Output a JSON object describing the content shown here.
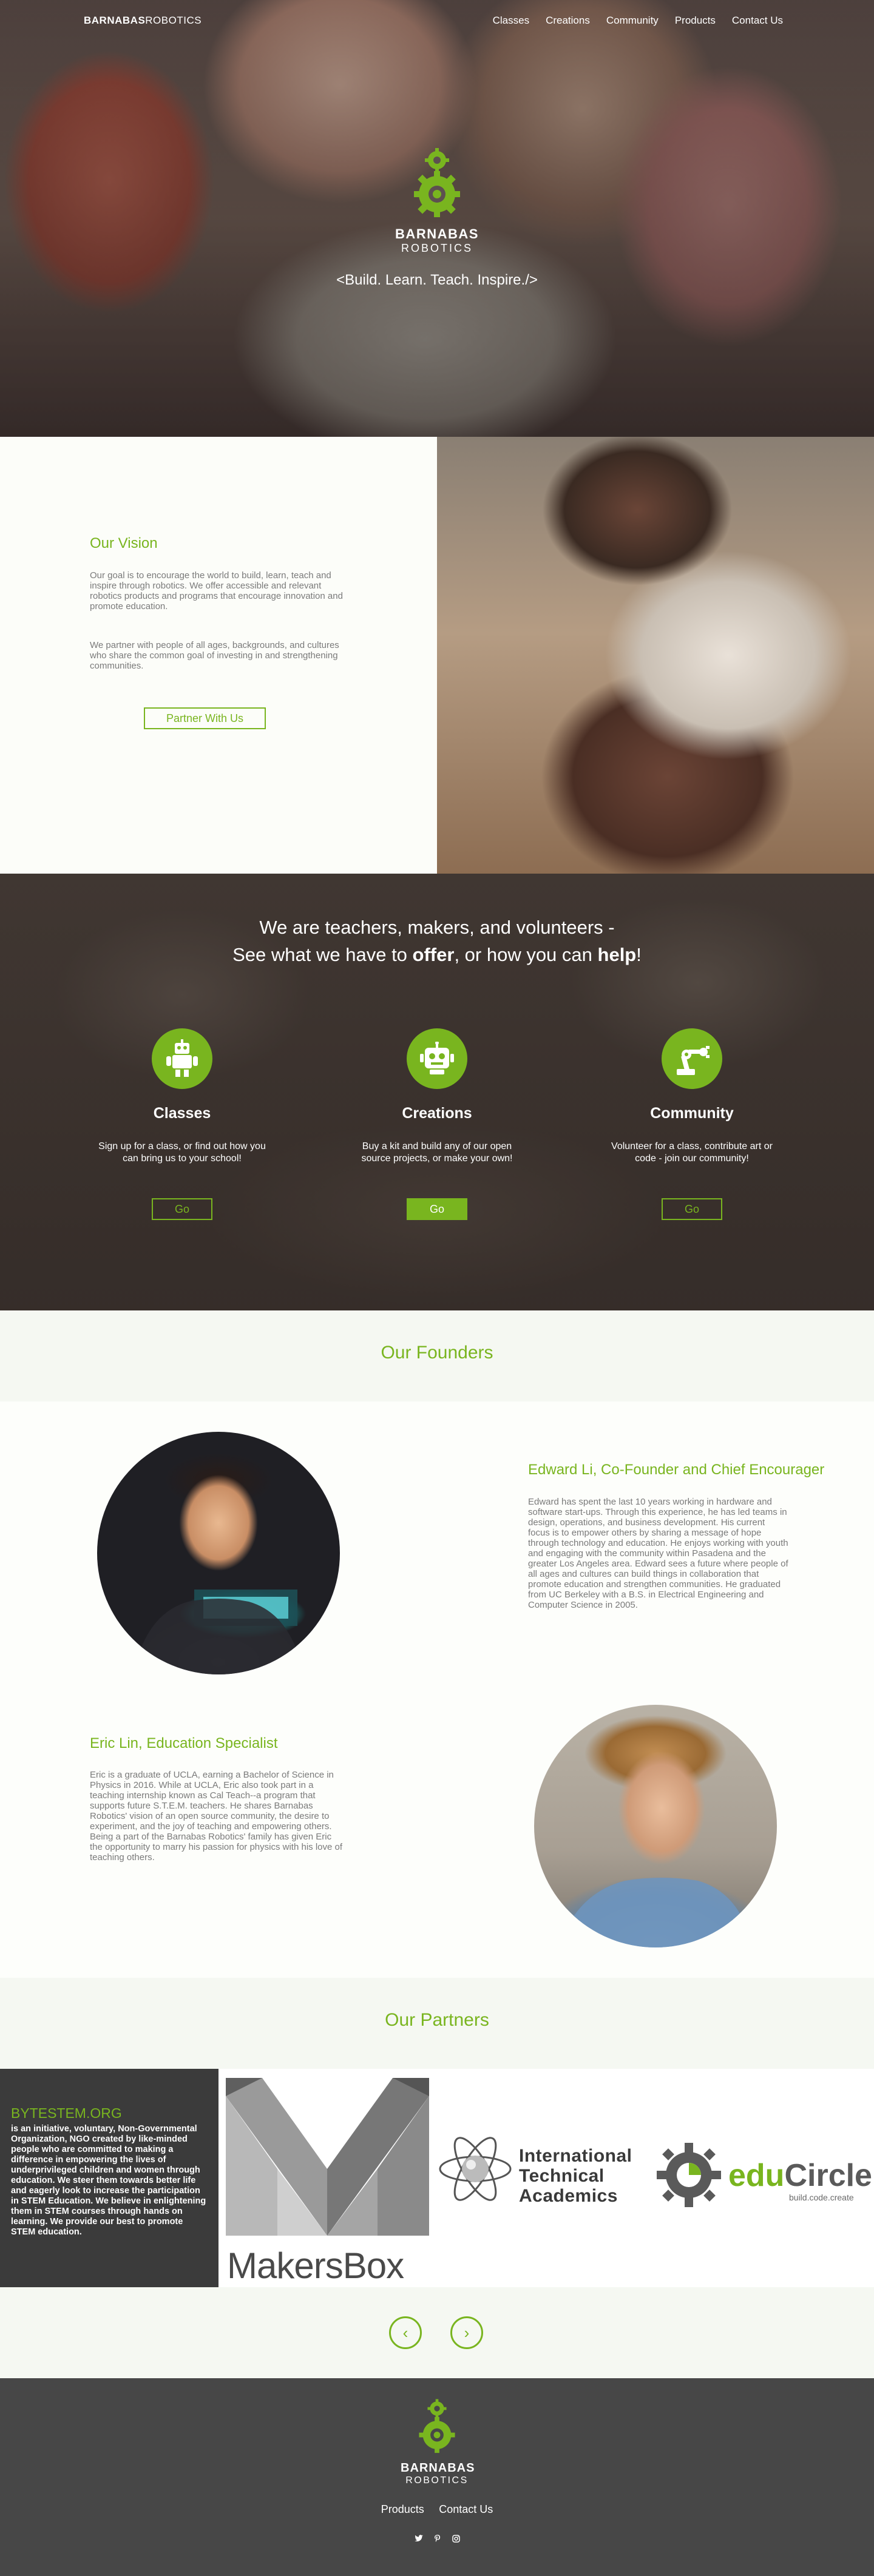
{
  "nav": {
    "brand_bold": "BARNABAS",
    "brand_light": "ROBOTICS",
    "links": [
      "Classes",
      "Creations",
      "Community",
      "Products",
      "Contact Us"
    ]
  },
  "hero": {
    "logo_top": "BARNABAS",
    "logo_bottom": "ROBOTICS",
    "tagline": "<Build. Learn. Teach. Inspire./>"
  },
  "vision": {
    "title": "Our Vision",
    "p1": "Our goal is to encourage the world to build, learn, teach and inspire through robotics. We offer accessible and relevant robotics products and programs that encourage innovation and promote education.",
    "p2": "We partner with people of all ages, backgrounds, and cultures who share the common goal of investing in and strengthening communities.",
    "button": "Partner With Us"
  },
  "offer": {
    "line1": "We are teachers, makers, and volunteers -",
    "line2_a": "See what we have to ",
    "line2_offer": "offer",
    "line2_b": ", or how you can ",
    "line2_help": "help",
    "line2_c": "!",
    "columns": [
      {
        "title": "Classes",
        "text": "Sign up for a class, or find out how you can bring us to your school!",
        "button": "Go",
        "icon": "robot-icon"
      },
      {
        "title": "Creations",
        "text": "Buy a kit and build any of our open source projects, or make your own!",
        "button": "Go",
        "icon": "robot-head-icon"
      },
      {
        "title": "Community",
        "text": "Volunteer for a class, contribute art or code - join our community!",
        "button": "Go",
        "icon": "robot-arm-icon"
      }
    ]
  },
  "founders": {
    "title": "Our Founders",
    "edward": {
      "name": "Edward Li, Co-Founder and Chief Encourager",
      "bio": "Edward has spent the last 10 years working in hardware and software start-ups.  Through this experience, he has led teams in design, operations, and business development.  His current focus is to empower others by sharing a message of hope through technology and education.  He enjoys working with youth and engaging with the community within Pasadena and the greater Los Angeles area.  Edward sees a future where people of all ages and cultures can build things in collaboration that promote education and strengthen communities.  He graduated from UC Berkeley with a B.S. in Electrical Engineering and Computer Science in 2005."
    },
    "eric": {
      "name": "Eric Lin, Education Specialist",
      "bio": "Eric is a graduate of UCLA, earning a Bachelor of Science in Physics in 2016.  While at UCLA, Eric also took part in a teaching internship known as Cal Teach--a program that supports future S.T.E.M. teachers.  He shares Barnabas Robotics' vision of an open source community, the desire to experiment, and the joy of teaching and empowering others.  Being a part of the Barnabas Robotics' family has given Eric the opportunity to marry his passion for physics with his love of teaching others."
    }
  },
  "partners": {
    "title": "Our Partners",
    "bytestem": {
      "title": "BYTESTEM.ORG",
      "text": "is an initiative, voluntary, Non-Governmental Organization, NGO created by like-minded people who are committed to making a difference in empowering the lives of underprivileged children and women through education. We steer them towards  better life and eagerly look to increase the participation in STEM Education. We believe in enlightening them in STEM courses through hands on learning. We provide our best to promote STEM education."
    },
    "makersbox": "MakersBox",
    "ita": [
      "International",
      "Technical",
      "Academics"
    ],
    "educircle_edu": "edu",
    "educircle_circle": "Circle",
    "educircle_sub": "build.code.create",
    "prev": "‹",
    "next": "›"
  },
  "footer": {
    "logo_top": "BARNABAS",
    "logo_bottom": "ROBOTICS",
    "links": [
      "Products",
      "Contact Us"
    ],
    "social": [
      "twitter-icon",
      "pinterest-icon",
      "instagram-icon"
    ]
  },
  "colors": {
    "accent": "#79b51f",
    "footer_bg": "#474747",
    "section_bg": "#f5f8f2"
  }
}
